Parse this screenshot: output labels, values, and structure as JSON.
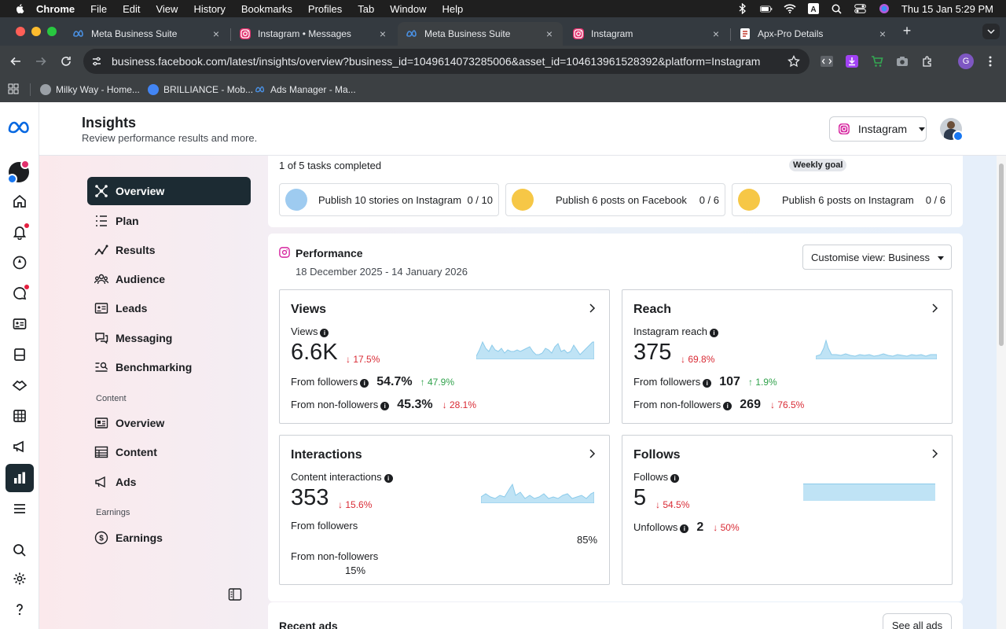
{
  "menubar": {
    "items": [
      "Chrome",
      "File",
      "Edit",
      "View",
      "History",
      "Bookmarks",
      "Profiles",
      "Tab",
      "Window",
      "Help"
    ],
    "clock": "Thu 15 Jan  5:29 PM"
  },
  "tabs": [
    {
      "label": "Meta Business Suite",
      "icon": "meta-icon",
      "active": false
    },
    {
      "label": "Instagram • Messages",
      "icon": "instagram-icon",
      "active": false
    },
    {
      "label": "Meta Business Suite",
      "icon": "meta-icon",
      "active": true
    },
    {
      "label": "Instagram",
      "icon": "instagram-icon",
      "active": false
    },
    {
      "label": "Apx-Pro Details",
      "icon": "doc-icon",
      "active": false
    }
  ],
  "omnibox": {
    "url_domain": "business.facebook.com",
    "url_path": "/latest/insights/overview?business_id=1049614073285006&asset_id=104613961528392&platform=Instagram"
  },
  "bookmarks": [
    {
      "label": "Milky Way - Home..."
    },
    {
      "label": "BRILLIANCE - Mob..."
    },
    {
      "label": "Ads Manager - Ma..."
    }
  ],
  "header": {
    "title": "Insights",
    "subtitle": "Review performance results and more.",
    "account": "Instagram"
  },
  "sidebar": {
    "items": [
      {
        "label": "Overview",
        "icon": "overview-icon"
      },
      {
        "label": "Plan",
        "icon": "plan-icon"
      },
      {
        "label": "Results",
        "icon": "results-icon"
      },
      {
        "label": "Audience",
        "icon": "audience-icon"
      },
      {
        "label": "Leads",
        "icon": "leads-icon"
      },
      {
        "label": "Messaging",
        "icon": "messaging-icon"
      },
      {
        "label": "Benchmarking",
        "icon": "benchmarking-icon"
      }
    ],
    "content_heading": "Content",
    "content_items": [
      {
        "label": "Overview",
        "icon": "content-overview-icon"
      },
      {
        "label": "Content",
        "icon": "content-table-icon"
      },
      {
        "label": "Ads",
        "icon": "ads-icon"
      }
    ],
    "earnings_heading": "Earnings",
    "earnings_items": [
      {
        "label": "Earnings",
        "icon": "earnings-icon"
      }
    ]
  },
  "goals": {
    "progress_text": "1 of 5 tasks completed",
    "badge": "Weekly goal",
    "tasks": [
      {
        "label": "Publish 10 stories on Instagram",
        "count": "0 / 10"
      },
      {
        "label": "Publish 6 posts on Facebook",
        "count": "0 / 6"
      },
      {
        "label": "Publish 6 posts on Instagram",
        "count": "0 / 6"
      }
    ]
  },
  "performance": {
    "title": "Performance",
    "date_range": "18 December 2025 - 14 January 2026",
    "customise_label": "Customise view: Business",
    "views": {
      "title": "Views",
      "metric_label": "Views",
      "value": "6.6K",
      "change": "17.5%",
      "followers_label": "From followers",
      "followers_pct": "54.7%",
      "followers_change": "47.9%",
      "nonfollowers_label": "From non-followers",
      "nonfollowers_pct": "45.3%",
      "nonfollowers_change": "28.1%"
    },
    "reach": {
      "title": "Reach",
      "metric_label": "Instagram reach",
      "value": "375",
      "change": "69.8%",
      "followers_label": "From followers",
      "followers_value": "107",
      "followers_change": "1.9%",
      "nonfollowers_label": "From non-followers",
      "nonfollowers_value": "269",
      "nonfollowers_change": "76.5%"
    },
    "interactions": {
      "title": "Interactions",
      "metric_label": "Content interactions",
      "value": "353",
      "change": "15.6%",
      "followers_label": "From followers",
      "followers_pct": "85%",
      "nonfollowers_label": "From non-followers",
      "nonfollowers_pct": "15%"
    },
    "follows": {
      "title": "Follows",
      "metric_label": "Follows",
      "value": "5",
      "change": "54.5%",
      "unfollows_label": "Unfollows",
      "unfollows_value": "2",
      "unfollows_change": "50%"
    }
  },
  "recent_ads": {
    "title": "Recent ads",
    "button": "See all ads"
  },
  "colors": {
    "active_nav": "#1c2b33",
    "down": "#d92b35",
    "up": "#31a24c",
    "spark": "#bfe3f5"
  }
}
